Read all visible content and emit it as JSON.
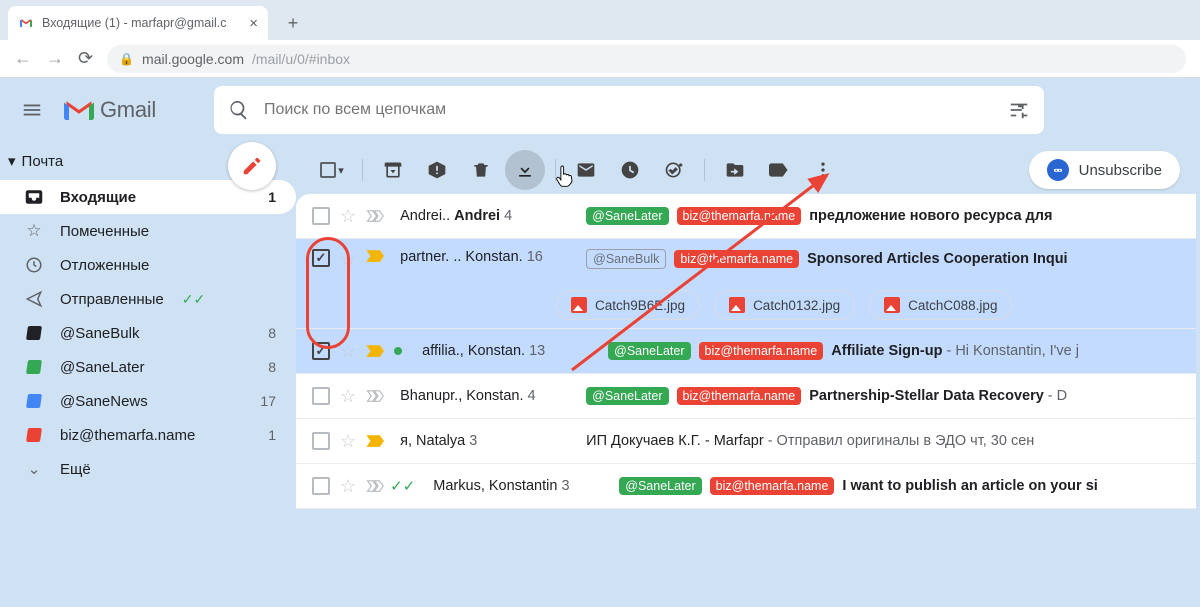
{
  "browser": {
    "tab_title": "Входящие (1) - marfapr@gmail.c",
    "url_host": "mail.google.com",
    "url_path": "/mail/u/0/#inbox"
  },
  "header": {
    "product": "Gmail",
    "search_placeholder": "Поиск по всем цепочкам"
  },
  "sidebar": {
    "section": "Почта",
    "more": "Ещё",
    "items": [
      {
        "icon": "inbox",
        "label": "Входящие",
        "count": "1",
        "active": true
      },
      {
        "icon": "star",
        "label": "Помеченные",
        "count": ""
      },
      {
        "icon": "clock",
        "label": "Отложенные",
        "count": ""
      },
      {
        "icon": "send",
        "label": "Отправленные",
        "count": "",
        "checks": true
      },
      {
        "icon": "lbl-black",
        "label": "@SaneBulk",
        "count": "8"
      },
      {
        "icon": "lbl-green",
        "label": "@SaneLater",
        "count": "8"
      },
      {
        "icon": "lbl-blue",
        "label": "@SaneNews",
        "count": "17"
      },
      {
        "icon": "lbl-red",
        "label": "biz@themarfa.name",
        "count": "1"
      }
    ]
  },
  "toolbar": {
    "unsubscribe": "Unsubscribe"
  },
  "pills": {
    "sanelater": "@SaneLater",
    "sanebulk": "@SaneBulk",
    "biz": "biz@themarfa.name"
  },
  "rows": [
    {
      "selected": false,
      "importance": "gray",
      "sender_html": "Andrei.. <b>Andrei</b>",
      "count": "4",
      "pill1": "sanelater_green",
      "pill2": "biz",
      "subject": "предложение нового ресурса для"
    },
    {
      "selected": true,
      "importance": "yellow",
      "sender_html": "partner. .. Konstan.",
      "count": "16",
      "pill1": "sanebulk_outline",
      "pill2": "biz",
      "subject": "Sponsored Articles Cooperation Inqui",
      "attachments": [
        "Catch9B6E.jpg",
        "Catch0132.jpg",
        "CatchC088.jpg"
      ]
    },
    {
      "selected": true,
      "importance": "yellow",
      "greenDot": true,
      "sender_html": "affilia., Konstan.",
      "count": "13",
      "pill1": "sanelater_green",
      "pill2": "biz",
      "subject": "Affiliate Sign-up",
      "snippet": " - Hi Konstantin, I've j"
    },
    {
      "selected": false,
      "importance": "gray",
      "sender_html": "Bhanupr., Konstan.",
      "count": "4",
      "pill1": "sanelater_green",
      "pill2": "biz",
      "subject": "Partnership-Stellar Data Recovery",
      "snippet": " - D"
    },
    {
      "selected": false,
      "importance": "yellow",
      "sender_html": "я, Natalya",
      "count": "3",
      "subject_plain": "ИП Докучаев К.Г. - Marfapr",
      "snippet": " - Отправил оригиналы в ЭДО чт, 30 сен"
    },
    {
      "selected": false,
      "importance": "gray",
      "dblcheck": true,
      "sender_html": "Markus, Konstantin",
      "count": "3",
      "pill1": "sanelater_green",
      "pill2": "biz",
      "subject": "I want to publish an article on your si"
    }
  ]
}
